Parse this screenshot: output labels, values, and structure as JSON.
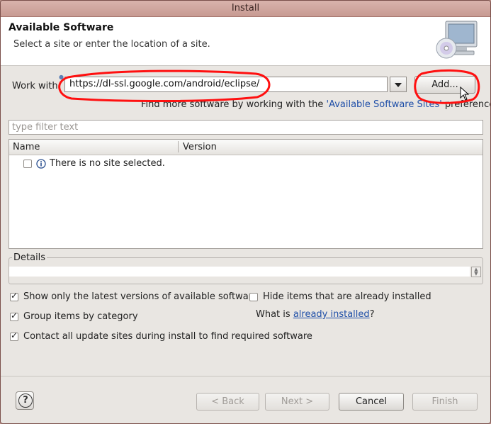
{
  "window": {
    "title": "Install"
  },
  "header": {
    "title": "Available Software",
    "subtitle": "Select a site or enter the location of a site.",
    "icon": "monitor-cd-icon"
  },
  "work_with": {
    "label": "Work with:",
    "value": "https://dl-ssl.google.com/android/eclipse/",
    "add_label": "Add...",
    "more_prefix": "Find more software by working with the ",
    "more_link": "'Available Software Sites'",
    "more_suffix": " preferences."
  },
  "filter": {
    "placeholder": "type filter text"
  },
  "tree": {
    "columns": [
      "Name",
      "Version"
    ],
    "rows": [
      {
        "text": "There is no site selected.",
        "icon": "info-icon",
        "checked": false
      }
    ]
  },
  "details": {
    "label": "Details"
  },
  "options": {
    "latest_versions": {
      "label": "Show only the latest versions of available software",
      "checked": true
    },
    "hide_installed": {
      "label": "Hide items that are already installed",
      "checked": false
    },
    "group_by_category": {
      "label": "Group items by category",
      "checked": true
    },
    "what_is_prefix": "What is ",
    "what_is_link": "already installed",
    "what_is_suffix": "?",
    "contact_sites": {
      "label": "Contact all update sites during install to find required software",
      "checked": true
    }
  },
  "footer": {
    "back": "< Back",
    "next": "Next >",
    "cancel": "Cancel",
    "finish": "Finish",
    "help_icon": "help-icon"
  },
  "colors": {
    "annotation": "#ff1010",
    "link": "#1f4fa8"
  }
}
